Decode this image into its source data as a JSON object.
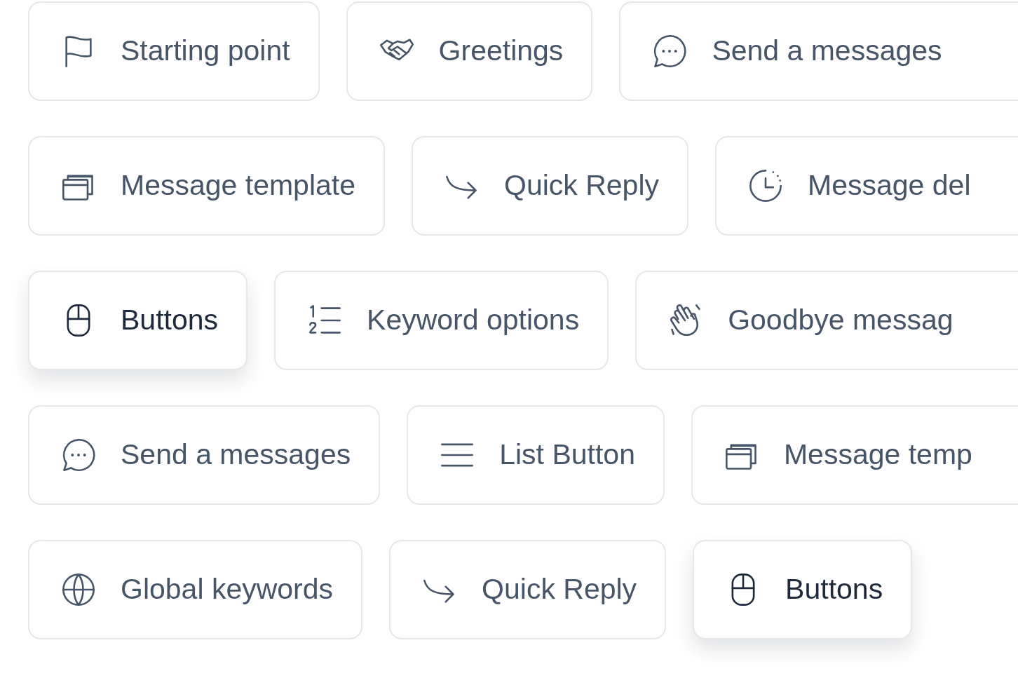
{
  "rows": [
    {
      "chips": [
        {
          "label": "Starting point",
          "raised": false,
          "clipped": false
        },
        {
          "label": "Greetings",
          "raised": false,
          "clipped": false
        },
        {
          "label": "Send a messages",
          "raised": false,
          "clipped": true
        }
      ]
    },
    {
      "chips": [
        {
          "label": "Message template",
          "raised": false,
          "clipped": false
        },
        {
          "label": "Quick Reply",
          "raised": false,
          "clipped": false
        },
        {
          "label": "Message del",
          "raised": false,
          "clipped": true
        }
      ]
    },
    {
      "chips": [
        {
          "label": "Buttons",
          "raised": true,
          "clipped": false
        },
        {
          "label": "Keyword options",
          "raised": false,
          "clipped": false
        },
        {
          "label": "Goodbye messag",
          "raised": false,
          "clipped": true
        }
      ]
    },
    {
      "chips": [
        {
          "label": "Send a messages",
          "raised": false,
          "clipped": false
        },
        {
          "label": "List Button",
          "raised": false,
          "clipped": false
        },
        {
          "label": "Message temp",
          "raised": false,
          "clipped": true
        }
      ]
    },
    {
      "chips": [
        {
          "label": "Global keywords",
          "raised": false,
          "clipped": false
        },
        {
          "label": "Quick Reply",
          "raised": false,
          "clipped": false
        },
        {
          "label": "Buttons",
          "raised": true,
          "clipped": false
        }
      ]
    }
  ]
}
